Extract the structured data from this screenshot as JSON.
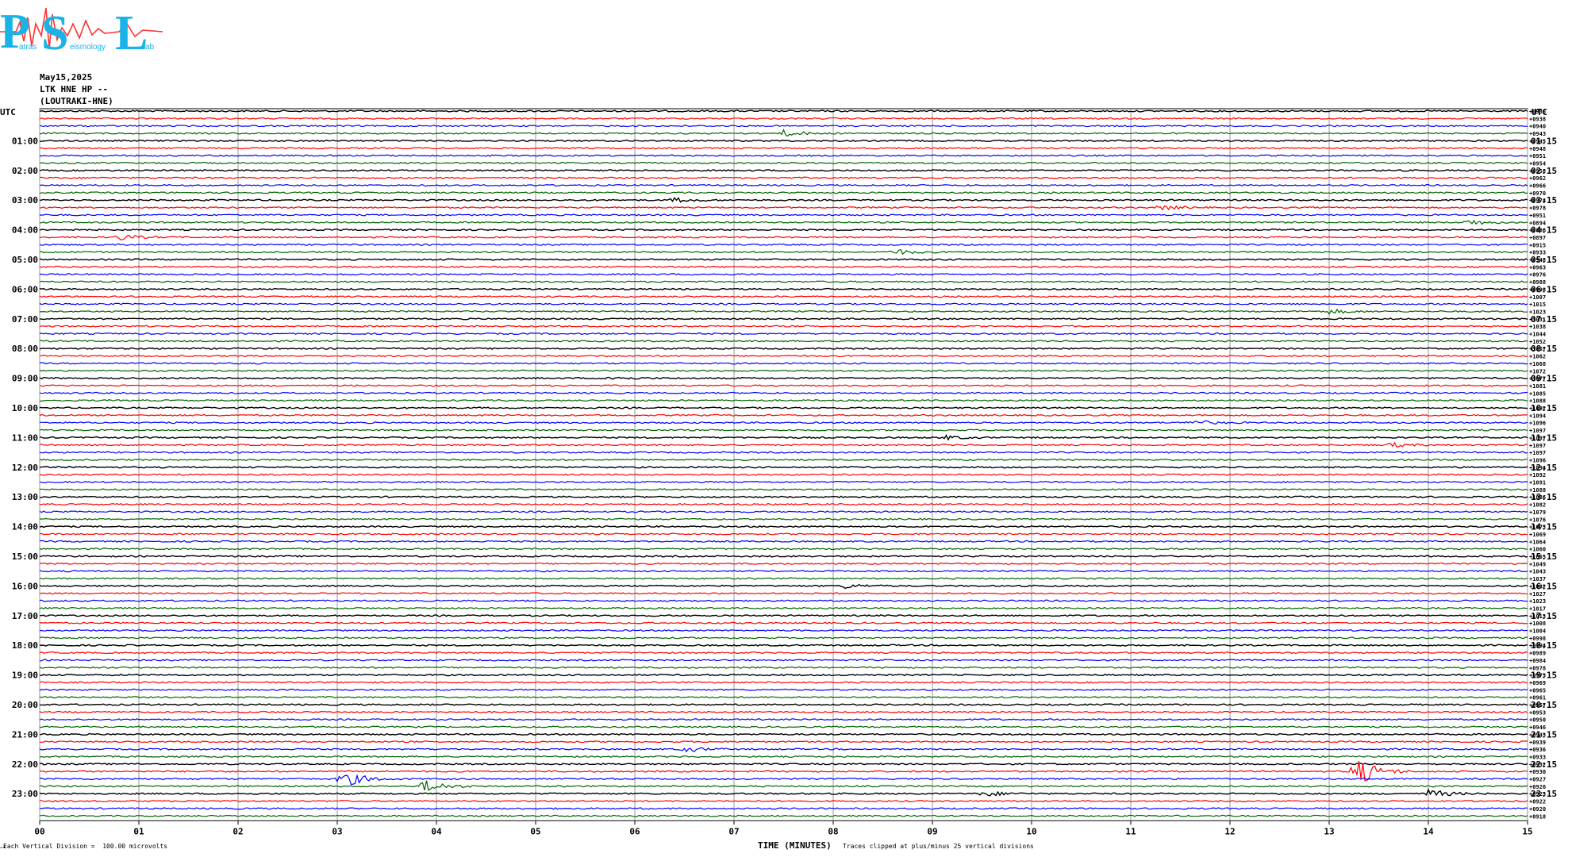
{
  "logo": {
    "letters": [
      "P",
      "S",
      "L"
    ],
    "subtitle_words": [
      "atras",
      "eismology",
      "ab"
    ]
  },
  "header": {
    "date": "May15,2025",
    "station": "LTK HNE HP --",
    "station_name": "(LOUTRAKI-HNE)"
  },
  "footnotes": {
    "left": "Each Vertical Division =  100.00 microvolts",
    "right": "Traces clipped at plus/minus 25 vertical divisions"
  },
  "colors": {
    "black": "#000000",
    "red": "#ff0000",
    "blue": "#0000ff",
    "green": "#006400",
    "grid": "#9a9a9a",
    "logo_cyan": "#1ab3e6",
    "logo_red": "#ff3333"
  },
  "chart_data": {
    "type": "line",
    "title": "",
    "xlabel": "TIME (MINUTES)",
    "ylabel": "",
    "x_ticks": [
      "00",
      "01",
      "02",
      "03",
      "04",
      "05",
      "06",
      "07",
      "08",
      "09",
      "10",
      "11",
      "12",
      "13",
      "14",
      "15"
    ],
    "xlim": [
      0,
      15
    ],
    "utc_label": "UTC",
    "left_hour_labels": [
      "01:00",
      "02:00",
      "03:00",
      "04:00",
      "05:00",
      "06:00",
      "07:00",
      "08:00",
      "09:00",
      "10:00",
      "11:00",
      "12:00",
      "13:00",
      "14:00",
      "15:00",
      "16:00",
      "17:00",
      "18:00",
      "19:00",
      "20:00",
      "21:00",
      "22:00",
      "23:00"
    ],
    "right_hour_labels": [
      "01:15",
      "02:15",
      "03:15",
      "04:15",
      "05:15",
      "06:15",
      "07:15",
      "08:15",
      "09:15",
      "10:15",
      "11:15",
      "12:15",
      "13:15",
      "14:15",
      "15:15",
      "16:15",
      "17:15",
      "18:15",
      "19:15",
      "20:15",
      "21:15",
      "22:15",
      "23:15"
    ],
    "trace_count": 96,
    "trace_minutes": 15,
    "color_cycle": [
      "black",
      "red",
      "blue",
      "green"
    ],
    "right_offset_values": [
      "+0936",
      "+0938",
      "+0940",
      "+0943",
      "+0945",
      "+0948",
      "+0951",
      "+0954",
      "+0958",
      "+0962",
      "+0966",
      "+0970",
      "+0974",
      "+0978",
      "+0951",
      "+0894",
      "+0886",
      "+0897",
      "+0915",
      "+0933",
      "+0948",
      "+0963",
      "+0976",
      "+0988",
      "+0998",
      "+1007",
      "+1015",
      "+1023",
      "+1031",
      "+1038",
      "+1044",
      "+1052",
      "+1057",
      "+1062",
      "+1068",
      "+1072",
      "+1077",
      "+1081",
      "+1085",
      "+1088",
      "+1092",
      "+1094",
      "+1096",
      "+1097",
      "+1097",
      "+1097",
      "+1097",
      "+1096",
      "+1094",
      "+1092",
      "+1091",
      "+1088",
      "+1086",
      "+1082",
      "+1079",
      "+1076",
      "+1073",
      "+1069",
      "+1064",
      "+1060",
      "+1055",
      "+1049",
      "+1043",
      "+1037",
      "+1032",
      "+1027",
      "+1023",
      "+1017",
      "+1013",
      "+1008",
      "+1004",
      "+0998",
      "+0994",
      "+0989",
      "+0984",
      "+0978",
      "+0973",
      "+0969",
      "+0965",
      "+0961",
      "+0957",
      "+0953",
      "+0950",
      "+0946",
      "+0943",
      "+0939",
      "+0936",
      "+0933",
      "+0932",
      "+0930",
      "+0927",
      "+0926",
      "+0923",
      "+0922",
      "+0920",
      "+0918"
    ],
    "events": [
      {
        "trace": 3,
        "minute": 7.5,
        "amplitude": 0.4
      },
      {
        "trace": 12,
        "minute": 6.4,
        "amplitude": 0.3
      },
      {
        "trace": 13,
        "minute": 11.3,
        "amplitude": 0.3
      },
      {
        "trace": 15,
        "minute": 14.4,
        "amplitude": 0.4
      },
      {
        "trace": 17,
        "minute": 0.8,
        "amplitude": 0.4
      },
      {
        "trace": 19,
        "minute": 8.6,
        "amplitude": 0.4
      },
      {
        "trace": 27,
        "minute": 13.0,
        "amplitude": 0.3
      },
      {
        "trace": 36,
        "minute": 5.7,
        "amplitude": 0.3
      },
      {
        "trace": 42,
        "minute": 11.6,
        "amplitude": 0.4
      },
      {
        "trace": 44,
        "minute": 9.1,
        "amplitude": 0.3
      },
      {
        "trace": 45,
        "minute": 13.6,
        "amplitude": 0.3
      },
      {
        "trace": 64,
        "minute": 8.1,
        "amplitude": 0.3
      },
      {
        "trace": 86,
        "minute": 6.5,
        "amplitude": 0.4
      },
      {
        "trace": 89,
        "minute": 13.25,
        "amplitude": 2.4
      },
      {
        "trace": 90,
        "minute": 3.05,
        "amplitude": 1.2
      },
      {
        "trace": 91,
        "minute": 3.85,
        "amplitude": 1.0
      },
      {
        "trace": 92,
        "minute": 9.5,
        "amplitude": 0.4
      },
      {
        "trace": 92,
        "minute": 14.0,
        "amplitude": 0.6
      }
    ]
  }
}
